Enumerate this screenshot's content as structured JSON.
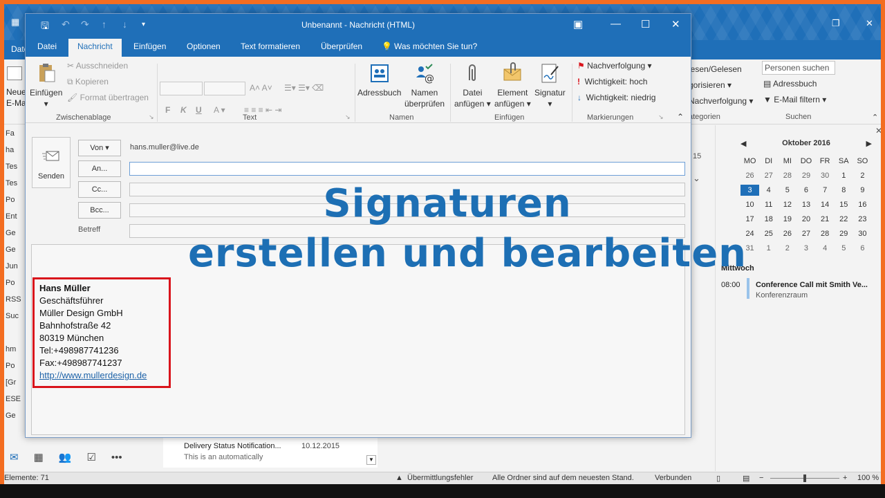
{
  "outlook_bg": {
    "datei_tab": "Datei",
    "new_email_label_1": "Neue",
    "new_email_label_2": "E-Ma",
    "ribbon_right": [
      "lesen/Gelesen",
      "gorisieren ▾",
      "Nachverfolgung ▾",
      "ategorien"
    ],
    "search_people": "Personen suchen",
    "address_book": "Adressbuch",
    "email_filter": "E-Mail filtern",
    "search_group": "Suchen",
    "folders": [
      "Fa",
      "ha",
      "Tes",
      "Tes",
      "Po",
      "Ent",
      "Ge",
      "Ge",
      "Jun",
      "Po",
      "RSS",
      "Suc",
      "",
      "hm",
      "Po",
      "[Gr",
      "ESE",
      "Ge"
    ],
    "date_stub": "15",
    "list_item": {
      "title": "Delivery Status Notification...",
      "date": "10.12.2015",
      "preview": "This is an automatically"
    },
    "calendar": {
      "month": "Oktober 2016",
      "weekdays": [
        "MO",
        "DI",
        "MI",
        "DO",
        "FR",
        "SA",
        "SO"
      ],
      "days": [
        "26",
        "27",
        "28",
        "29",
        "30",
        "1",
        "2",
        "3",
        "4",
        "5",
        "6",
        "7",
        "8",
        "9",
        "10",
        "11",
        "12",
        "13",
        "14",
        "15",
        "16",
        "17",
        "18",
        "19",
        "20",
        "21",
        "22",
        "23",
        "24",
        "25",
        "26",
        "27",
        "28",
        "29",
        "30",
        "31",
        "1",
        "2",
        "3",
        "4",
        "5",
        "6"
      ],
      "selected_index": 7
    },
    "agenda": {
      "day": "Mittwoch",
      "time": "08:00",
      "title": "Conference Call mit Smith Ve...",
      "location": "Konferenzraum"
    },
    "status": {
      "items": "Elemente: 71",
      "error": "Übermittlungsfehler",
      "uptodate": "Alle Ordner sind auf dem neuesten Stand.",
      "connected": "Verbunden",
      "zoom": "100 %"
    }
  },
  "compose": {
    "title": "Unbenannt - Nachricht (HTML)",
    "tabs": [
      "Datei",
      "Nachricht",
      "Einfügen",
      "Optionen",
      "Text formatieren",
      "Überprüfen",
      "Was möchten Sie tun?"
    ],
    "ribbon": {
      "paste": "Einfügen",
      "cut": "Ausschneiden",
      "copy": "Kopieren",
      "format_painter": "Format übertragen",
      "group_clipboard": "Zwischenablage",
      "group_text": "Text",
      "bold": "F",
      "italic": "K",
      "underline": "U",
      "address_book": "Adressbuch",
      "check_names_1": "Namen",
      "check_names_2": "überprüfen",
      "group_names": "Namen",
      "attach_file_1": "Datei",
      "attach_file_2": "anfügen",
      "attach_item_1": "Element",
      "attach_item_2": "anfügen",
      "signature": "Signatur",
      "group_insert": "Einfügen",
      "follow_up": "Nachverfolgung",
      "high_importance": "Wichtigkeit: hoch",
      "low_importance": "Wichtigkeit: niedrig",
      "group_tags": "Markierungen"
    },
    "send": "Senden",
    "from_btn": "Von",
    "from_value": "hans.muller@live.de",
    "to_btn": "An...",
    "cc_btn": "Cc...",
    "bcc_btn": "Bcc...",
    "subject_label": "Betreff",
    "signature": {
      "name": "Hans Müller",
      "role": "Geschäftsführer",
      "company": "Müller Design GmbH",
      "street": "Bahnhofstraße 42",
      "city": "80319 München",
      "tel": "Tel:+498987741236",
      "fax": "Fax:+498987741237",
      "web": "http://www.mullerdesign.de"
    }
  },
  "overlay": {
    "line1": "Signaturen",
    "line2": "erstellen und bearbeiten"
  },
  "colors": {
    "accent": "#1f6fb8",
    "frame": "#f36d21",
    "highlight": "#d9141c"
  }
}
